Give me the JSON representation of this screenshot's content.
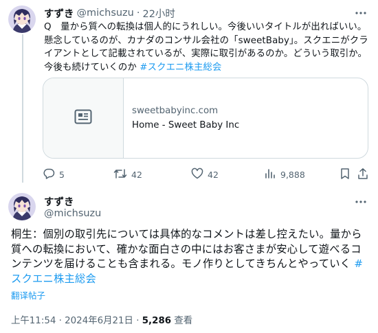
{
  "colors": {
    "accent": "#1d9bf0",
    "secondary_text": "#536471",
    "primary_text": "#0f1419",
    "border": "#cfd9de"
  },
  "tweet1": {
    "display_name": "すずき",
    "handle": "@michsuzu",
    "separator": "·",
    "time": "22小时",
    "more_icon": "more-horizontal-icon",
    "text": "Q　量から質への転換は個人的にうれしい。今後いいタイトルが出ればいい。懸念しているのが、カナダのコンサル会社の「sweetBaby」。スクエニがクライアントとして記載されているが、実際に取引があるのか。どういう取引か。今後も続けていくのか ",
    "hashtag": "#スクエニ株主総会",
    "link_card": {
      "icon": "article-icon",
      "domain": "sweetbabyinc.com",
      "title": "Home - Sweet Baby Inc"
    },
    "actions": {
      "replies": "5",
      "retweets": "42",
      "likes": "42",
      "views": "9,888"
    }
  },
  "tweet2": {
    "display_name": "すずき",
    "handle": "@michsuzu",
    "more_icon": "more-horizontal-icon",
    "text": "桐生：個別の取引先については具体的なコメントは差し控えたい。量から質への転換において、確かな面白さの中にはお客さまが安心して遊べるコンテンツを届けることも含まれる。モノ作りとしてきちんとやっていく ",
    "hashtag": "#スクエニ株主総会",
    "translate_label": "翻译帖子",
    "timestamp": "上午11:54 · 2024年6月21日 · ",
    "views_count": "5,286",
    "views_label": " 查看"
  }
}
